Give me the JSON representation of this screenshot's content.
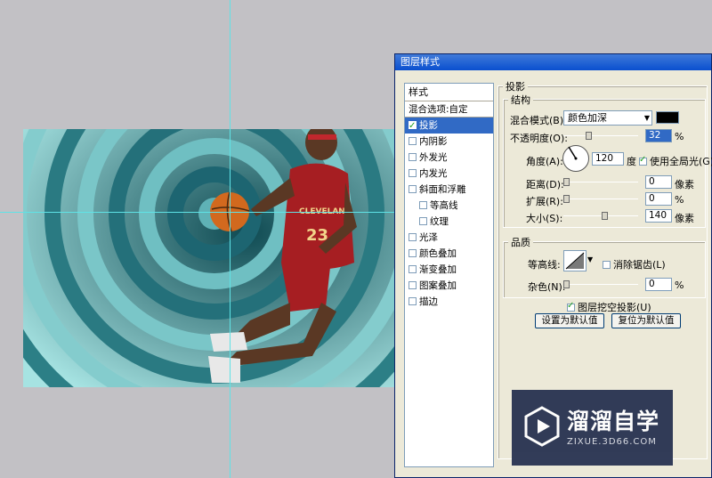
{
  "dialog": {
    "title": "图层样式"
  },
  "styles_panel": {
    "header": "样式",
    "blend_options": "混合选项:自定",
    "items": [
      {
        "label": "投影",
        "checked": true,
        "selected": true,
        "sub": false
      },
      {
        "label": "内阴影",
        "checked": false,
        "selected": false,
        "sub": false
      },
      {
        "label": "外发光",
        "checked": false,
        "selected": false,
        "sub": false
      },
      {
        "label": "内发光",
        "checked": false,
        "selected": false,
        "sub": false
      },
      {
        "label": "斜面和浮雕",
        "checked": false,
        "selected": false,
        "sub": false
      },
      {
        "label": "等高线",
        "checked": false,
        "selected": false,
        "sub": true
      },
      {
        "label": "纹理",
        "checked": false,
        "selected": false,
        "sub": true
      },
      {
        "label": "光泽",
        "checked": false,
        "selected": false,
        "sub": false
      },
      {
        "label": "颜色叠加",
        "checked": false,
        "selected": false,
        "sub": false
      },
      {
        "label": "渐变叠加",
        "checked": false,
        "selected": false,
        "sub": false
      },
      {
        "label": "图案叠加",
        "checked": false,
        "selected": false,
        "sub": false
      },
      {
        "label": "描边",
        "checked": false,
        "selected": false,
        "sub": false
      }
    ]
  },
  "drop_shadow": {
    "section_title": "投影",
    "structure": {
      "title": "结构",
      "blend_mode_label": "混合模式(B):",
      "blend_mode_value": "颜色加深",
      "opacity_label": "不透明度(O):",
      "opacity_value": "32",
      "opacity_unit": "%",
      "angle_label": "角度(A):",
      "angle_value": "120",
      "angle_unit": "度",
      "global_light_label": "使用全局光(G)",
      "global_light_checked": true,
      "distance_label": "距离(D):",
      "distance_value": "0",
      "distance_unit": "像素",
      "spread_label": "扩展(R):",
      "spread_value": "0",
      "spread_unit": "%",
      "size_label": "大小(S):",
      "size_value": "140",
      "size_unit": "像素",
      "shadow_color": "#000000"
    },
    "quality": {
      "title": "品质",
      "contour_label": "等高线:",
      "anti_alias_label": "消除锯齿(L)",
      "anti_alias_checked": false,
      "noise_label": "杂色(N):",
      "noise_value": "0",
      "noise_unit": "%"
    },
    "knockout_label": "图层挖空投影(U)",
    "knockout_checked": true,
    "set_default_label": "设置为默认值",
    "reset_default_label": "复位为默认值"
  },
  "watermark": {
    "title": "溜溜自学",
    "subtitle": "ZIXUE.3D66.COM"
  },
  "canvas": {
    "jersey_text": "CLEVELAND",
    "jersey_number": "23"
  }
}
